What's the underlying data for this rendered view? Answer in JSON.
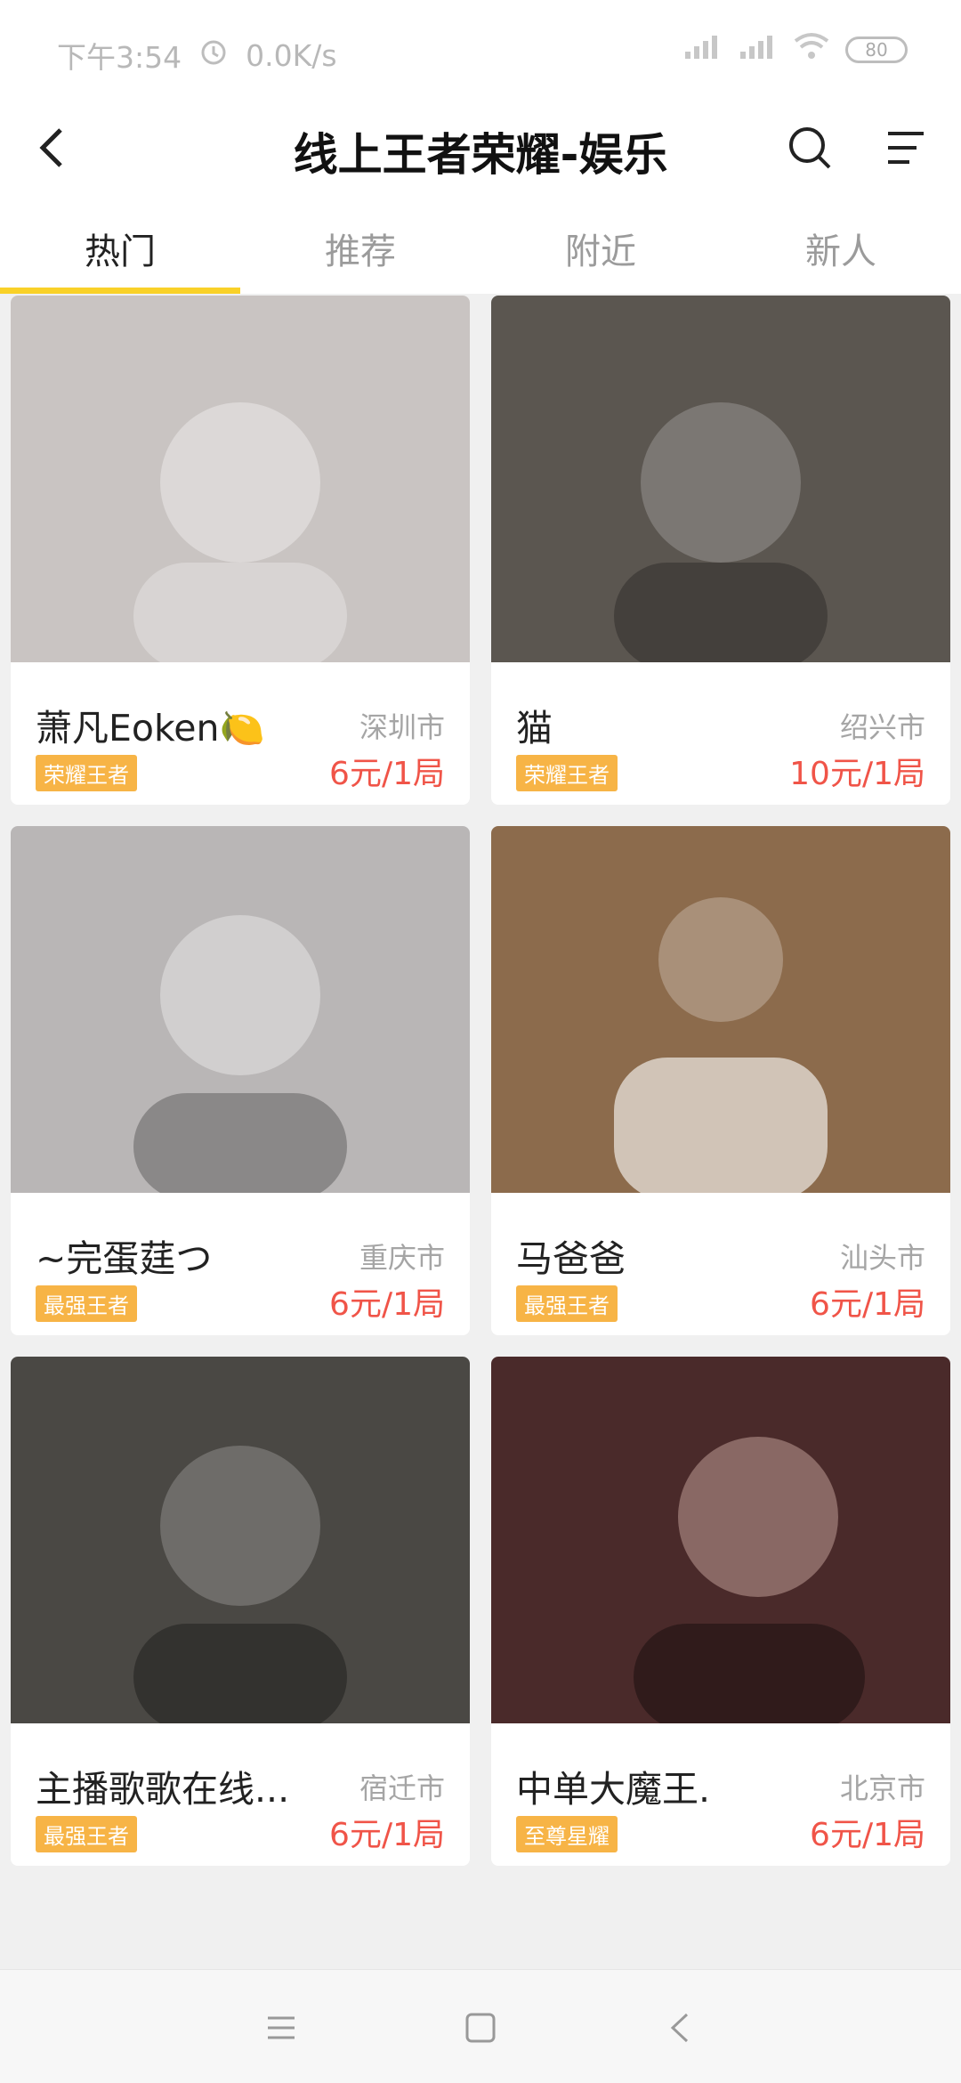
{
  "status_bar": {
    "time": "下午3:54",
    "alarm_icon": "alarm-icon",
    "speed": "0.0K/s",
    "battery": "80"
  },
  "nav": {
    "title": "线上王者荣耀-娱乐"
  },
  "tabs": [
    {
      "label": "热门",
      "active": true
    },
    {
      "label": "推荐",
      "active": false
    },
    {
      "label": "附近",
      "active": false
    },
    {
      "label": "新人",
      "active": false
    }
  ],
  "cards": [
    {
      "name": "萧凡Eoken🍋",
      "city": "深圳市",
      "badge": "荣耀王者",
      "price": "6元/1局",
      "photo_color": "#c9c4c2"
    },
    {
      "name": "猫",
      "city": "绍兴市",
      "badge": "荣耀王者",
      "price": "10元/1局",
      "photo_color": "#5b5650"
    },
    {
      "name": "~完蛋莛つ",
      "city": "重庆市",
      "badge": "最强王者",
      "price": "6元/1局",
      "photo_color": "#b9b6b6"
    },
    {
      "name": "马爸爸",
      "city": "汕头市",
      "badge": "最强王者",
      "price": "6元/1局",
      "photo_color": "#8c6b4c"
    },
    {
      "name": "主播歌歌在线...",
      "city": "宿迁市",
      "badge": "最强王者",
      "price": "6元/1局",
      "photo_color": "#4a4844"
    },
    {
      "name": "中单大魔王.",
      "city": "北京市",
      "badge": "至尊星耀",
      "price": "6元/1局",
      "photo_color": "#4a2a2a"
    }
  ],
  "colors": {
    "accent": "#f9d128",
    "price": "#f05448",
    "badge": "#f7b446"
  }
}
